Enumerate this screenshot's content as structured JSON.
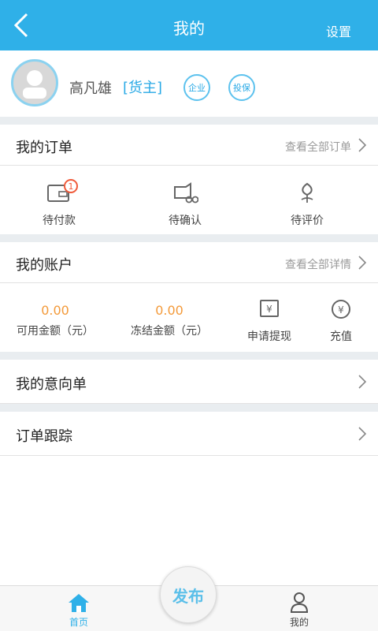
{
  "header": {
    "title": "我的",
    "settings_label": "设置"
  },
  "profile": {
    "name": "高凡雄",
    "role": "[货主]",
    "badge_enterprise": "企业",
    "badge_insurance": "投保"
  },
  "orders": {
    "title": "我的订单",
    "link": "查看全部订单",
    "items": [
      {
        "label": "待付款",
        "badge": "1"
      },
      {
        "label": "待确认"
      },
      {
        "label": "待评价"
      }
    ]
  },
  "account": {
    "title": "我的账户",
    "link": "查看全部详情",
    "available_value": "0.00",
    "available_label": "可用金额（元）",
    "frozen_value": "0.00",
    "frozen_label": "冻结金额（元）",
    "withdraw_label": "申请提现",
    "recharge_label": "充值",
    "currency_symbol": "¥"
  },
  "intent": {
    "title": "我的意向单"
  },
  "tracking": {
    "title": "订单跟踪"
  },
  "nav": {
    "home": "首页",
    "publish": "发布",
    "mine": "我的"
  },
  "colors": {
    "accent": "#2fb0e8",
    "value_orange": "#f39a3a",
    "badge_red": "#f05a3a"
  }
}
